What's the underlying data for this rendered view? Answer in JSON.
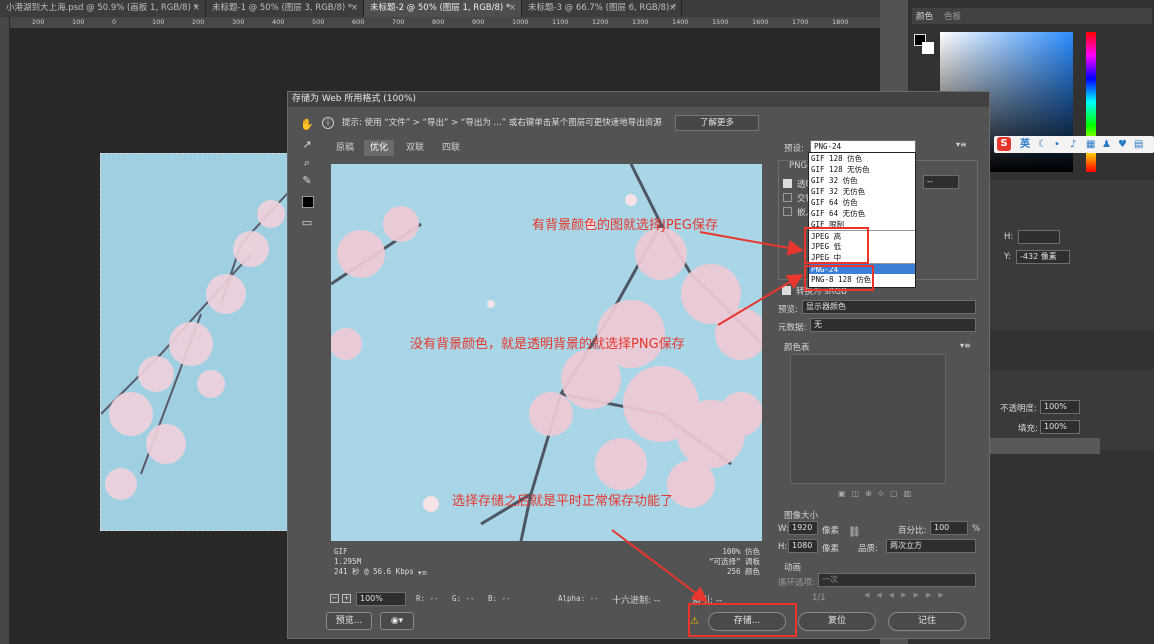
{
  "tabs": [
    {
      "label": "小港湖到大上海.psd @ 50.9% (画板 1, RGB/8) *",
      "active": false
    },
    {
      "label": "未标题-1 @ 50% (图层 3, RGB/8) *",
      "active": false
    },
    {
      "label": "未标题-2 @ 50% (图层 1, RGB/8) *",
      "active": true
    },
    {
      "label": "未标题-3 @ 66.7% (图层 6, RGB/8) *",
      "active": false
    }
  ],
  "ruler_labels": [
    "200",
    "100",
    "0",
    "100",
    "200",
    "300",
    "400",
    "500",
    "600",
    "700",
    "800",
    "900",
    "1000",
    "1100",
    "1200",
    "1300",
    "1400",
    "1500",
    "1600",
    "1700",
    "1800"
  ],
  "right_panels": {
    "color_tab": "颜色",
    "swatches_tab": "色板",
    "h_label": "H:",
    "y_label": "Y:",
    "y_value": "-432 像素",
    "opacity_label": "不透明度:",
    "opacity_value": "100%",
    "fill_label": "填充:",
    "fill_value": "100%"
  },
  "ime": {
    "logo": "S",
    "lang": "英"
  },
  "dialog": {
    "title": "存储为 Web 所用格式 (100%)",
    "tip": "提示:  使用 “文件” > “导出” > “导出为 ...” 或右键单击某个图层可更快速地导出资源",
    "learn_more": "了解更多",
    "view_tabs": [
      "原稿",
      "优化",
      "双联",
      "四联"
    ],
    "preview_info_left": [
      "GIF",
      "1.295M",
      "241 秒 @ 56.6 Kbps"
    ],
    "preview_info_right": [
      "100% 仿色",
      "“可选择” 调板",
      "256 颜色"
    ],
    "zoom": "100%",
    "status": {
      "r": "R: --",
      "g": "G: --",
      "b": "B: --",
      "alpha": "Alpha: --",
      "hex": "十六进制: --",
      "index": "索引: --"
    },
    "preview_button": "预览...",
    "save_button": "存储...",
    "reset_button": "复位",
    "remember_button": "记住",
    "preset_label": "预设:",
    "preset_value": "PNG-24",
    "preset_options": [
      "GIF 128 仿色",
      "GIF 128 无仿色",
      "GIF 32 仿色",
      "GIF 32 无仿色",
      "GIF 64 仿色",
      "GIF 64 无仿色",
      "GIF 限制",
      "JPEG 高",
      "JPEG 低",
      "JPEG 中",
      "PNG-24",
      "PNG-8 128 仿色"
    ],
    "selected_preset_index": 10,
    "format_partial": "PNG-",
    "options_partial": [
      "透明",
      "交错",
      "嵌入"
    ],
    "matte_value": "--",
    "convert_partial": "转换为 sRGB",
    "preview_label": "预览:",
    "preview_value": "显示器颜色",
    "metadata_label": "元数据:",
    "metadata_value": "无",
    "color_table_label": "颜色表",
    "image_size_label": "图像大小",
    "w_label": "W:",
    "w_value": "1920",
    "h_label": "H:",
    "h_value": "1080",
    "px_unit": "像素",
    "percent_label": "百分比:",
    "percent_value": "100",
    "percent_unit": "%",
    "quality_label": "品质:",
    "quality_value": "两次立方",
    "animation_label": "动画",
    "loop_label": "循环选项:",
    "loop_value": "一次",
    "frame_counter": "1/1"
  },
  "annotations": {
    "jpeg_note": "有背景颜色的图就选择JPEG保存",
    "png_note": "没有背景颜色，就是透明背景的就选择PNG保存",
    "save_note": "选择存储之后就是平时正常保存功能了"
  },
  "colors": {
    "annotation": "#e8362d",
    "selection": "#3b7fd6",
    "sky": "#a9d6e6"
  }
}
